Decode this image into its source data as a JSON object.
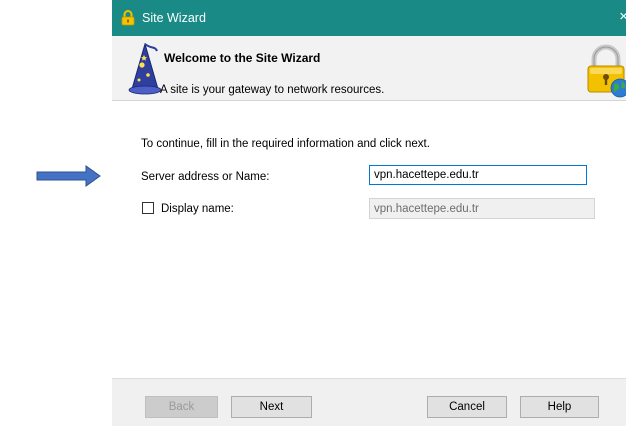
{
  "window": {
    "title": "Site Wizard",
    "close_glyph": "×",
    "accent_color": "#1a8a86"
  },
  "header": {
    "title": "Welcome to the Site Wizard",
    "subtitle": "A site is your gateway to network resources.",
    "left_icon": "wizard-icon",
    "right_icon": "lock-globe-icon"
  },
  "form": {
    "instructions": "To continue, fill in the required information and click next.",
    "server_label": "Server address or Name:",
    "server_value": "vpn.hacettepe.edu.tr",
    "display_label": "Display name:",
    "display_value": "vpn.hacettepe.edu.tr",
    "display_checked": false
  },
  "buttons": {
    "back": "Back",
    "next": "Next",
    "cancel": "Cancel",
    "help": "Help"
  },
  "annotation": {
    "arrow_color": "#4472c4"
  }
}
